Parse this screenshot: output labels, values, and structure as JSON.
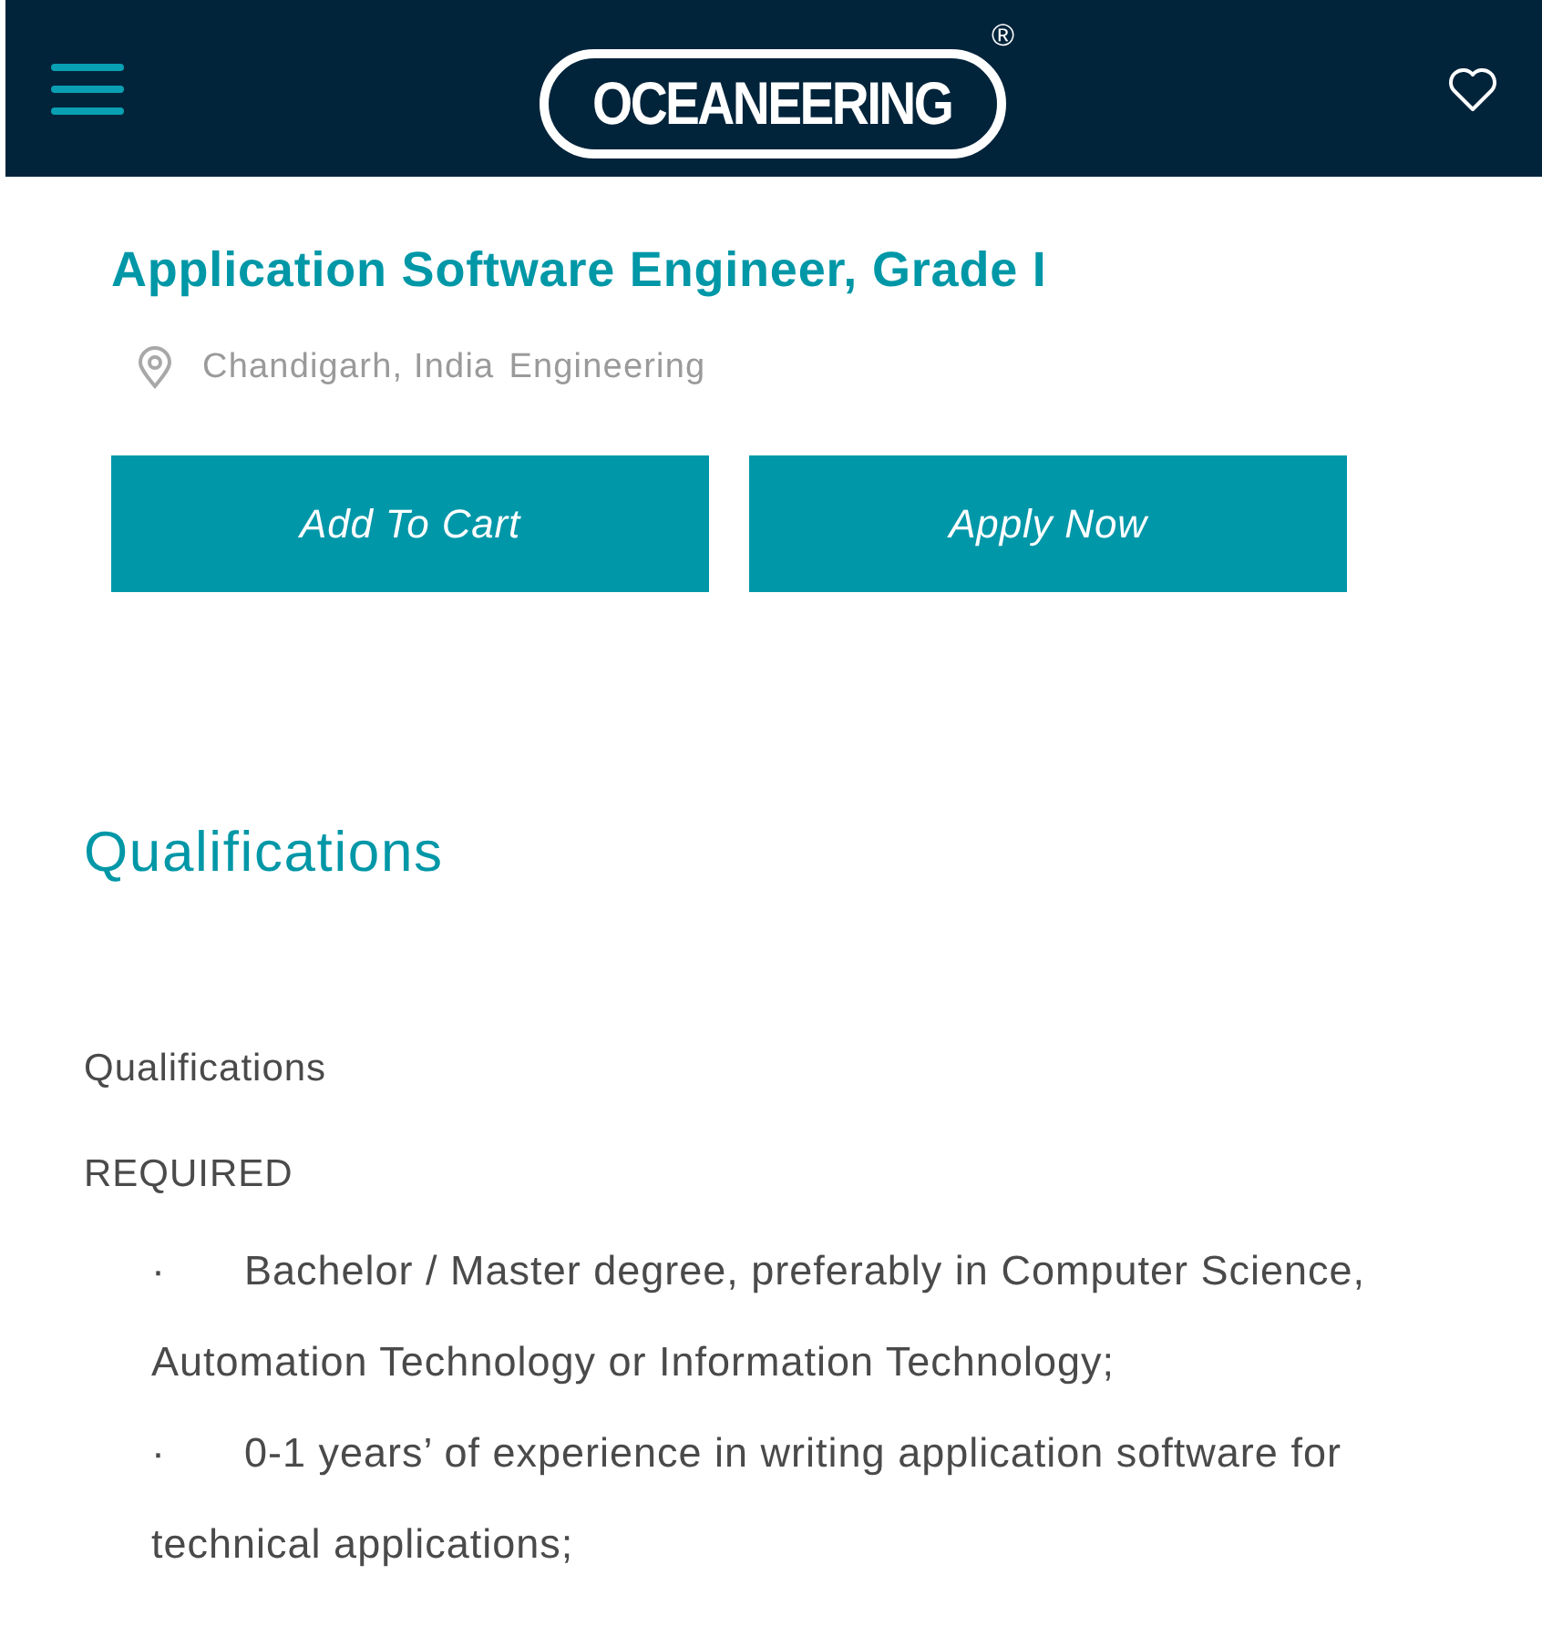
{
  "header": {
    "logo": {
      "text": "OCEANEERING",
      "mark": "®"
    }
  },
  "job": {
    "title": "Application Software Engineer, Grade I",
    "location": "Chandigarh, India",
    "category": "Engineering"
  },
  "buttons": [
    "Add To Cart",
    "Apply Now"
  ],
  "section": {
    "heading": "Qualifications",
    "paragraphs": [
      "Qualifications",
      "REQUIRED"
    ],
    "items": [
      {
        "bullet": "·",
        "text": "Bachelor / Master degree, preferably in Computer Science, Automation Technology or Information Technology;"
      },
      {
        "bullet": "·",
        "text": "0-1 years’ of experience in writing application software for technical applications;"
      }
    ]
  }
}
